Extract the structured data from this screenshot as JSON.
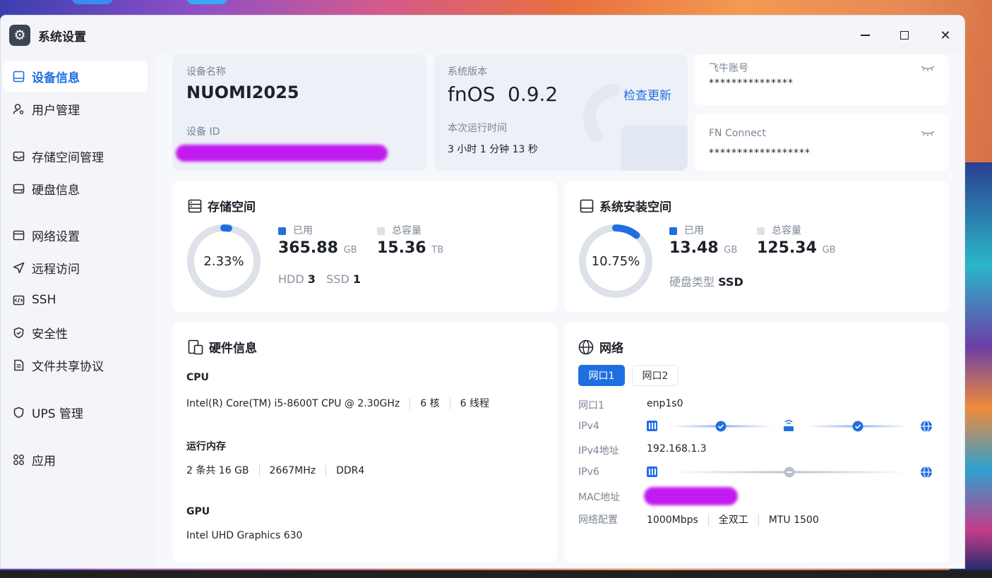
{
  "window": {
    "title": "系统设置",
    "app_icon": "gear-icon"
  },
  "sidebar": {
    "items": [
      {
        "label": "设备信息",
        "icon": "device-info-icon",
        "active": true
      },
      {
        "label": "用户管理",
        "icon": "user-icon"
      },
      {
        "label": "存储空间管理",
        "icon": "storage-icon"
      },
      {
        "label": "硬盘信息",
        "icon": "disk-icon"
      },
      {
        "label": "网络设置",
        "icon": "network-settings-icon"
      },
      {
        "label": "远程访问",
        "icon": "remote-access-icon"
      },
      {
        "label": "SSH",
        "icon": "ssh-icon"
      },
      {
        "label": "安全性",
        "icon": "shield-icon"
      },
      {
        "label": "文件共享协议",
        "icon": "file-share-icon"
      },
      {
        "label": "UPS 管理",
        "icon": "ups-icon"
      },
      {
        "label": "应用",
        "icon": "apps-icon"
      }
    ]
  },
  "device": {
    "name_label": "设备名称",
    "name": "NUOMI2025",
    "id_label": "设备 ID"
  },
  "system": {
    "version_label": "系统版本",
    "os": "fnOS",
    "version": "0.9.2",
    "check_update": "检查更新",
    "uptime_label": "本次运行时间",
    "uptime": "3 小时 1 分钟 13 秒"
  },
  "accounts": {
    "feiniu_label": "飞牛账号",
    "feiniu_value": "***************",
    "fnconnect_label": "FN Connect",
    "fnconnect_value": "******************"
  },
  "storage": {
    "title": "存储空间",
    "percent_text": "2.33%",
    "percent": 2.33,
    "used_label": "已用",
    "used_value": "365.88",
    "used_unit": "GB",
    "total_label": "总容量",
    "total_value": "15.36",
    "total_unit": "TB",
    "hdd_label": "HDD",
    "hdd_count": "3",
    "ssd_label": "SSD",
    "ssd_count": "1"
  },
  "system_space": {
    "title": "系统安装空间",
    "percent_text": "10.75%",
    "percent": 10.75,
    "used_label": "已用",
    "used_value": "13.48",
    "used_unit": "GB",
    "total_label": "总容量",
    "total_value": "125.34",
    "total_unit": "GB",
    "disk_type_label": "硬盘类型",
    "disk_type": "SSD"
  },
  "hardware": {
    "title": "硬件信息",
    "cpu_label": "CPU",
    "cpu_model": "Intel(R) Core(TM) i5-8600T CPU @ 2.30GHz",
    "cpu_cores": "6 核",
    "cpu_threads": "6 线程",
    "ram_label": "运行内存",
    "ram_sticks": "2 条共 16 GB",
    "ram_speed": "2667MHz",
    "ram_type": "DDR4",
    "gpu_label": "GPU",
    "gpu_model": "Intel UHD Graphics 630"
  },
  "network": {
    "title": "网络",
    "tabs": [
      "网口1",
      "网口2"
    ],
    "port_label": "网口1",
    "port_value": "enp1s0",
    "ipv4_label": "IPv4",
    "ipv4_addr_label": "IPv4地址",
    "ipv4_addr": "192.168.1.3",
    "ipv6_label": "IPv6",
    "mac_label": "MAC地址",
    "config_label": "网络配置",
    "speed": "1000Mbps",
    "duplex": "全双工",
    "mtu": "MTU 1500"
  },
  "colors": {
    "accent": "#1f6fe0",
    "ring_track": "#dde1e8",
    "redaction": "#c21bf0"
  }
}
